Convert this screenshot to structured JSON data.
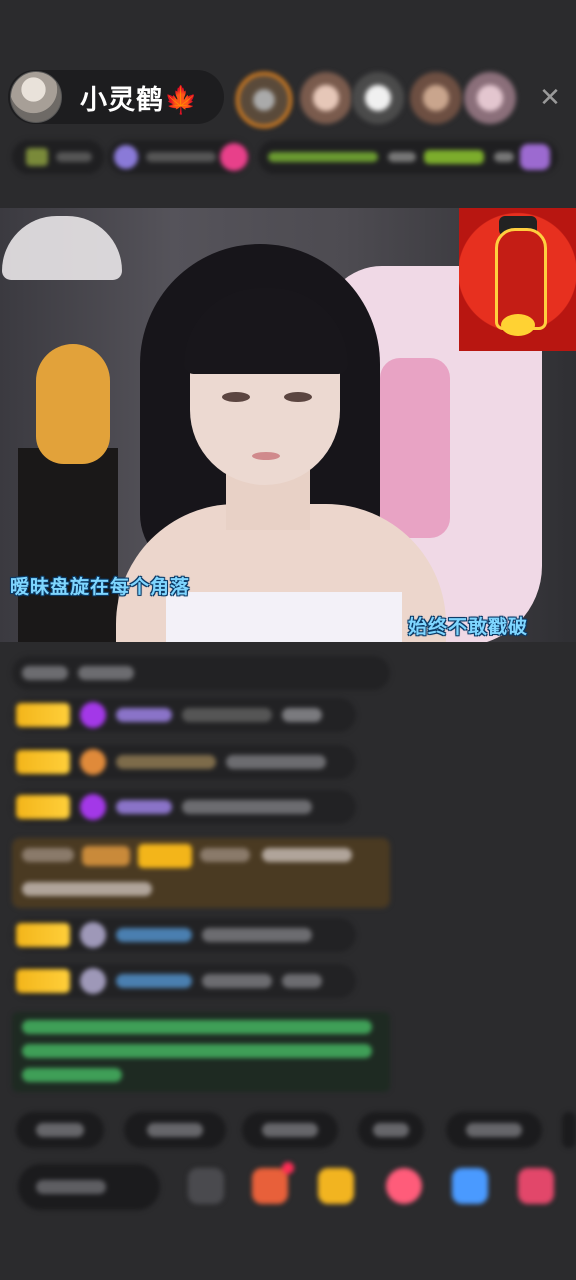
{
  "header": {
    "host_name": "小灵鹤🍁",
    "close_icon": "close-icon"
  },
  "video": {
    "caption_left": "暧昧盘旋在每个角落",
    "caption_right": "始终不敢戳破"
  },
  "colors": {
    "background": "#2b2b2d",
    "badge_gold": "#f3b51a",
    "caption_blue": "#7fd6ff"
  }
}
